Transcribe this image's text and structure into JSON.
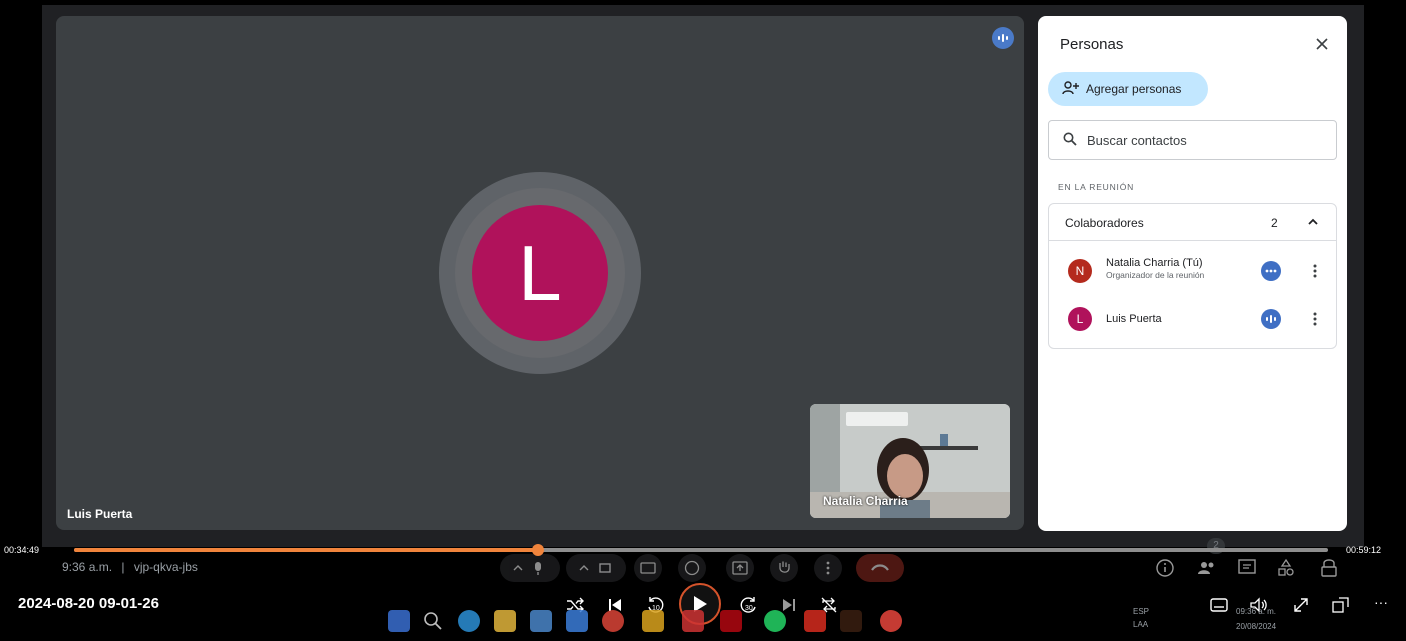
{
  "meeting": {
    "main_tile_name": "Luis Puerta",
    "avatar_letter": "L",
    "self_tile_name": "Natalia Charria",
    "time": "9:36 a.m.",
    "separator": "|",
    "code": "vjp-qkva-jbs"
  },
  "people_panel": {
    "title": "Personas",
    "add_label": "Agregar personas",
    "search_placeholder": "Buscar contactos",
    "section_label": "EN LA REUNIÓN",
    "group_label": "Colaboradores",
    "group_count": "2",
    "participants": [
      {
        "initial": "N",
        "name": "Natalia Charria (Tú)",
        "role": "Organizador de la reunión",
        "color": "#b42a1d"
      },
      {
        "initial": "L",
        "name": "Luis Puerta",
        "role": "",
        "color": "#b0125b"
      }
    ]
  },
  "meet_bar": {
    "people_count": "2"
  },
  "player": {
    "elapsed": "00:34:49",
    "remaining": "00:59:12",
    "progress": 0.37,
    "file_title": "2024-08-20 09-01-26",
    "accent": "#f0843c",
    "skip_back": "10",
    "skip_forward": "30",
    "more": "···"
  },
  "taskbar": {
    "lang": "ESP",
    "lang2": "LAA",
    "clock_time": "09:36 a. m.",
    "clock_date": "20/08/2024"
  }
}
